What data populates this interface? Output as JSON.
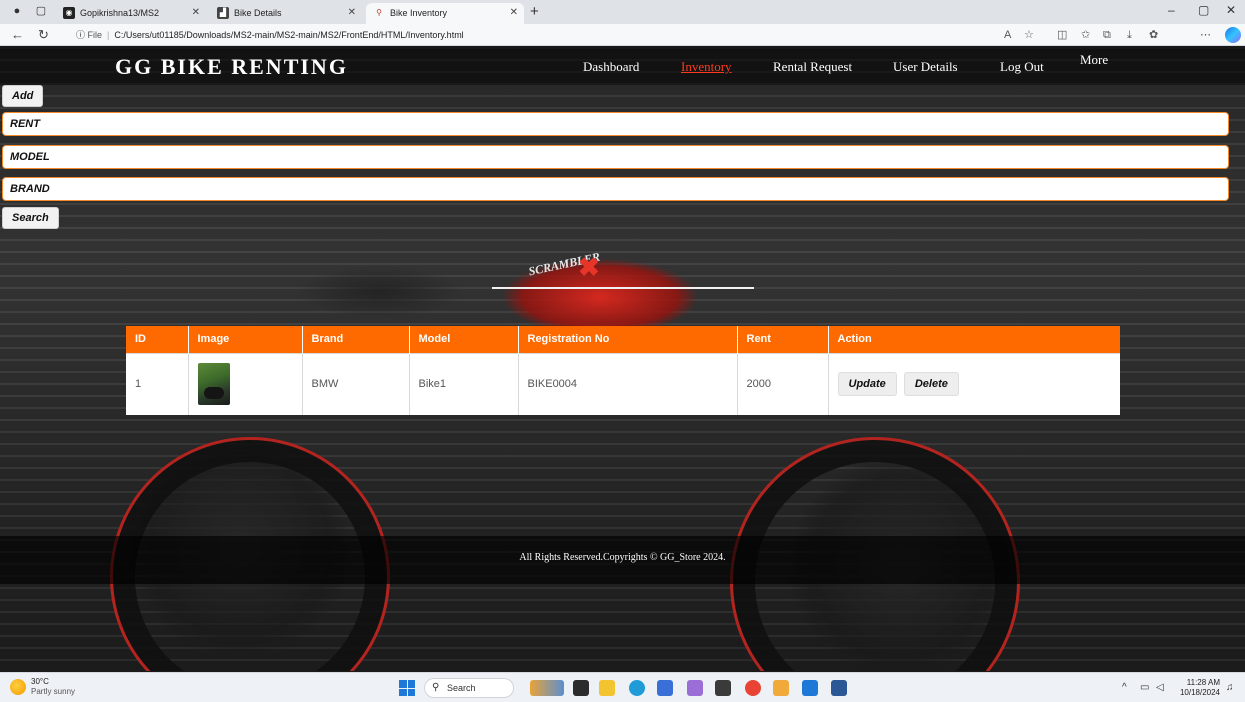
{
  "browser": {
    "tabs": [
      {
        "label": "Gopikrishna13/MS2",
        "active": false
      },
      {
        "label": "Bike Details",
        "active": false
      },
      {
        "label": "Bike Inventory",
        "active": true
      }
    ],
    "url_scheme": "File",
    "url": "C:/Users/ut01185/Downloads/MS2-main/MS2-main/MS2/FrontEnd/HTML/Inventory.html"
  },
  "nav": {
    "brand": "GG BIKE RENTING",
    "links": [
      "Dashboard",
      "Inventory",
      "Rental Request",
      "User Details",
      "Log Out"
    ],
    "active": "Inventory",
    "more": "More"
  },
  "form": {
    "add_label": "Add",
    "rent_placeholder": "RENT",
    "model_placeholder": "MODEL",
    "brand_placeholder": "BRAND",
    "search_label": "Search"
  },
  "table": {
    "columns": [
      "ID",
      "Image",
      "Brand",
      "Model",
      "Registration No",
      "Rent",
      "Action"
    ],
    "rows": [
      {
        "id": "1",
        "brand": "BMW",
        "model": "Bike1",
        "registration": "BIKE0004",
        "rent": "2000"
      }
    ],
    "update_label": "Update",
    "delete_label": "Delete"
  },
  "footer": "All Rights Reserved.Copyrights © GG_Store 2024.",
  "taskbar": {
    "temperature": "30°C",
    "condition": "Partly sunny",
    "search": "Search",
    "time": "11:28 AM",
    "date": "10/18/2024"
  },
  "colors": {
    "accent": "#ff6a00",
    "active_link": "#ff3b1f",
    "field_border": "#f28a2c"
  }
}
